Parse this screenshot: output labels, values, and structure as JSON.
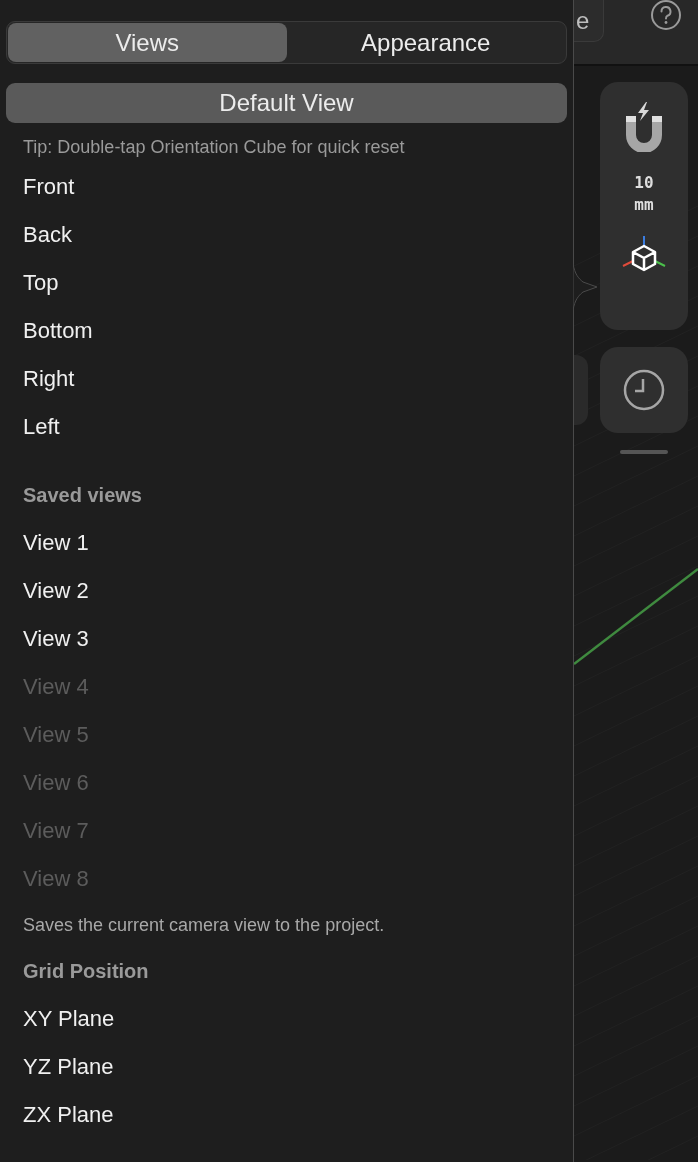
{
  "tabs": [
    {
      "label": "Views",
      "selected": true
    },
    {
      "label": "Appearance",
      "selected": false
    }
  ],
  "default_view_button": "Default View",
  "tip": "Tip: Double-tap Orientation Cube for quick reset",
  "standard_views": [
    "Front",
    "Back",
    "Top",
    "Bottom",
    "Right",
    "Left"
  ],
  "saved_views_heading": "Saved views",
  "saved_views": [
    {
      "label": "View 1",
      "disabled": false
    },
    {
      "label": "View 2",
      "disabled": false
    },
    {
      "label": "View 3",
      "disabled": false
    },
    {
      "label": "View 4",
      "disabled": true
    },
    {
      "label": "View 5",
      "disabled": true
    },
    {
      "label": "View 6",
      "disabled": true
    },
    {
      "label": "View 7",
      "disabled": true
    },
    {
      "label": "View 8",
      "disabled": true
    }
  ],
  "saved_views_hint": "Saves the current camera view to the project.",
  "grid_position_heading": "Grid Position",
  "grid_positions": [
    "XY Plane",
    "YZ Plane",
    "ZX Plane"
  ],
  "top_bar": {
    "partial_button": "e"
  },
  "toolbar": {
    "snap_value": "10",
    "snap_unit": "mm"
  }
}
